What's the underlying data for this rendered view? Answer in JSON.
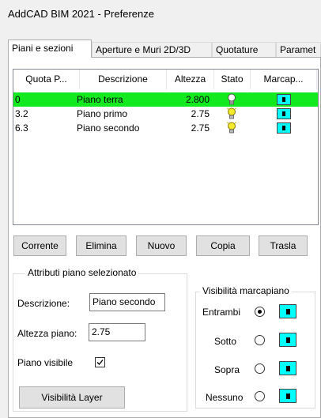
{
  "window": {
    "title": "AddCAD BIM 2021 - Preferenze"
  },
  "tabs": [
    "Piani e sezioni",
    "Aperture e Muri 2D/3D",
    "Quotature",
    "Paramet"
  ],
  "grid": {
    "headers": [
      "Quota P...",
      "Descrizione",
      "Altezza",
      "Stato",
      "Marcap..."
    ],
    "rows": [
      {
        "quota": "0",
        "descrizione": "Piano terra",
        "altezza": "2.800",
        "stato_icon": "lightbulb-off-icon",
        "marcapiano_icon": "marcapiano-icon"
      },
      {
        "quota": "3.2",
        "descrizione": "Piano primo",
        "altezza": "2.75",
        "stato_icon": "lightbulb-on-icon",
        "marcapiano_icon": "marcapiano-icon"
      },
      {
        "quota": "6.3",
        "descrizione": "Piano secondo",
        "altezza": "2.75",
        "stato_icon": "lightbulb-on-icon",
        "marcapiano_icon": "marcapiano-icon"
      }
    ],
    "selected_row_color": "#12e91e"
  },
  "buttons": {
    "corrente": "Corrente",
    "elimina": "Elimina",
    "nuovo": "Nuovo",
    "copia": "Copia",
    "trasla": "Trasla"
  },
  "attributes": {
    "group_label": "Attributi piano selezionato",
    "descrizione_label": "Descrizione:",
    "descrizione_value": "Piano secondo",
    "altezza_label": "Altezza piano:",
    "altezza_value": "2.75",
    "visibile_label": "Piano visibile",
    "visibile_checked": true,
    "visibilita_layer": "Visibilità Layer"
  },
  "visibilita": {
    "group_label": "Visibilità marcapiano",
    "options": [
      "Entrambi",
      "Sotto",
      "Sopra",
      "Nessuno"
    ],
    "selected": "Entrambi"
  },
  "colors": {
    "marcapiano": "#00ffff",
    "bulb_on": "#f2ea2a"
  }
}
